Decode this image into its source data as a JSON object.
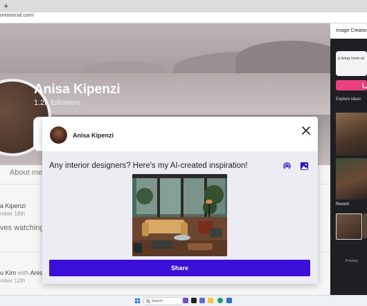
{
  "browser": {
    "new_tab": "+",
    "url": "ontosocial.com/"
  },
  "profile": {
    "name": "Anisa Kipenzi",
    "followers": "1.2k followers",
    "about_tab": "About me"
  },
  "feed": [
    {
      "author": "a Kipenzi",
      "date": "mber 18th",
      "text": "ves watching"
    },
    {
      "author_prefix": "u Kim",
      "with_word": "with",
      "author_suffix": "Anis",
      "date": "mber 12th"
    }
  ],
  "sidebar": {
    "title": "Image Creator",
    "prompt": "a living room wi",
    "explore_label": "Explore ideas",
    "recent_label": "Recent",
    "privacy_label": "Privacy"
  },
  "modal": {
    "author": "Anisa Kipenzi",
    "post_text": "Any interior designers? Here's my AI-created inspiration!",
    "share_label": "Share"
  },
  "taskbar": {
    "search_label": "Search"
  },
  "colors": {
    "share_button": "#3c0fd9",
    "accent_icons": "#2d13c8",
    "create_button": "#e8417c",
    "sidebar_bg": "#1f1f23"
  }
}
